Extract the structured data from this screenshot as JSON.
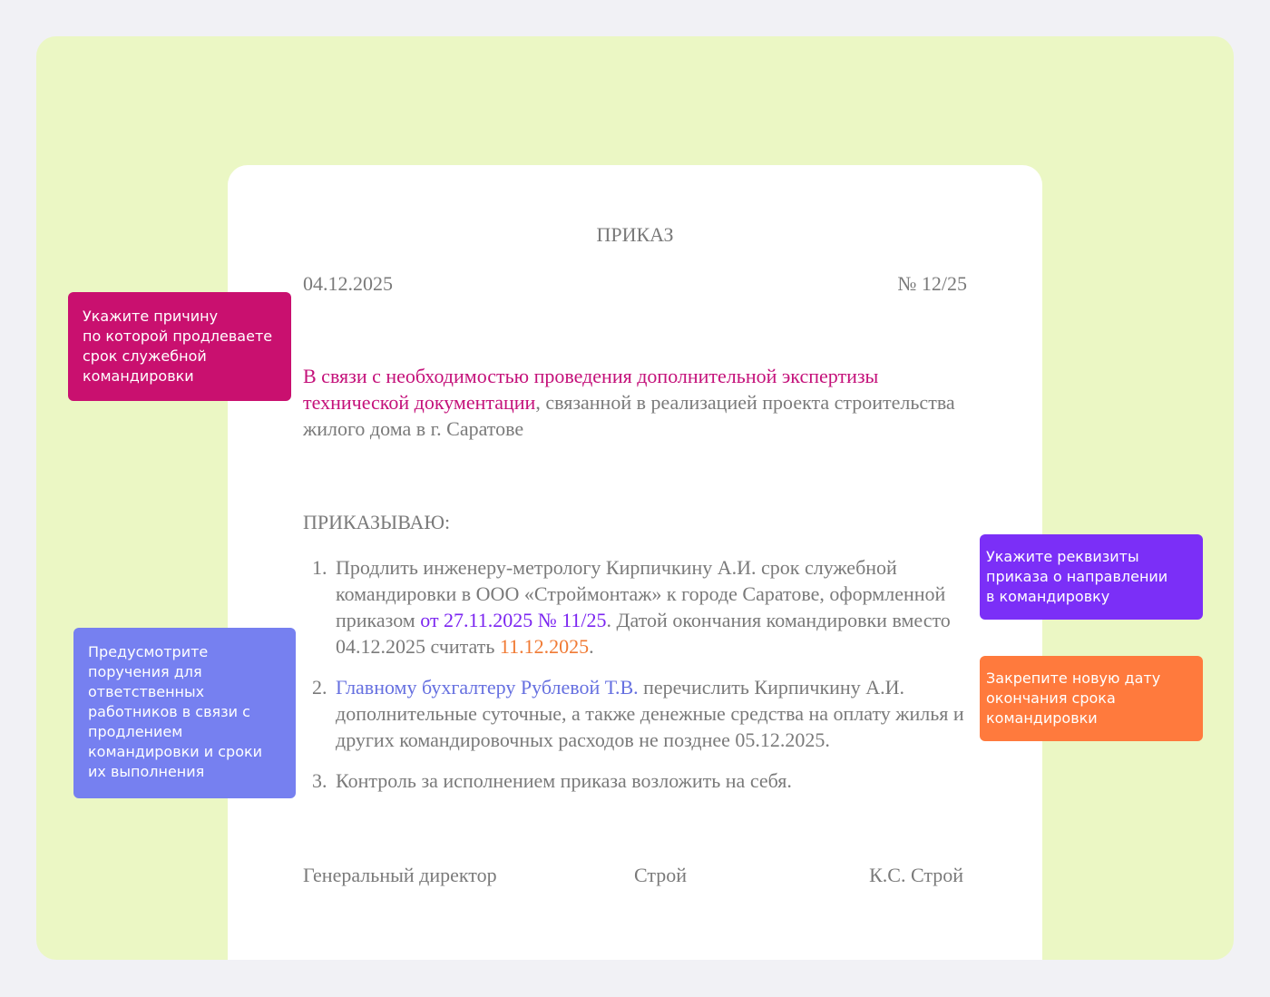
{
  "document": {
    "title": "ПРИКАЗ",
    "date": "04.12.2025",
    "number": "№ 12/25",
    "reason": {
      "highlight": "В связи с необходимостью проведения дополнительной экспертизы технической документации",
      "rest": ", связанной в реализацией проекта строительства жилого дома в г. Саратове"
    },
    "order_word": "ПРИКАЗЫВАЮ:",
    "items": [
      {
        "num": "1.",
        "part1": "Продлить инженеру-метрологу Кирпичкину А.И. срок служебной командировки в ООО «Строймонтаж» к городе Саратове, оформленной приказом ",
        "order_ref": "от 27.11.2025 № 11/25",
        "part2": ". Датой окончания командировки вместо 04.12.2025 считать ",
        "new_date": "11.12.2025",
        "part3": "."
      },
      {
        "num": "2.",
        "person": "Главному бухгалтеру Рублевой Т.В.",
        "rest": " перечислить Кирпичкину А.И. дополнительные суточные, а также денежные средства на оплату жилья и других командировочных расходов не позднее 05.12.2025."
      },
      {
        "num": "3.",
        "text": "Контроль за исполнением приказа возложить на себя."
      }
    ],
    "signature": {
      "role": "Генеральный директор",
      "sign": "Строй",
      "name": "К.С. Строй"
    }
  },
  "notes": {
    "reason": [
      "Укажите причину",
      "по которой продлеваете",
      "срок служебной",
      "командировки"
    ],
    "assign": [
      "Предусмотрите",
      "поручения для",
      "ответственных",
      "работников в связи с",
      "продлением",
      "командировки и сроки",
      "их выполнения"
    ],
    "order": [
      "Укажите реквизиты",
      "приказа о направлении",
      "в командировку"
    ],
    "date": [
      "Закрепите новую дату",
      "окончания срока",
      "командировки"
    ]
  },
  "colors": {
    "frame": "#ebf7c4",
    "reason": "#c9106f",
    "assign": "#7680f0",
    "order": "#7b2ff7",
    "date": "#ff7a3d"
  }
}
